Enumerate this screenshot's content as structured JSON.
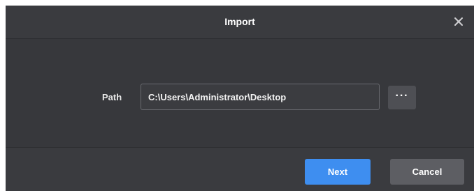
{
  "dialog": {
    "title": "Import",
    "close_icon": "close-icon"
  },
  "form": {
    "path_label": "Path",
    "path_value": "C:\\Users\\Administrator\\Desktop",
    "browse_label": "···",
    "browse_icon": "more-icon"
  },
  "footer": {
    "next_label": "Next",
    "cancel_label": "Cancel"
  },
  "colors": {
    "accent": "#3e8ef0",
    "dialog_bg": "#37383c",
    "secondary_button": "#5d5e63"
  }
}
